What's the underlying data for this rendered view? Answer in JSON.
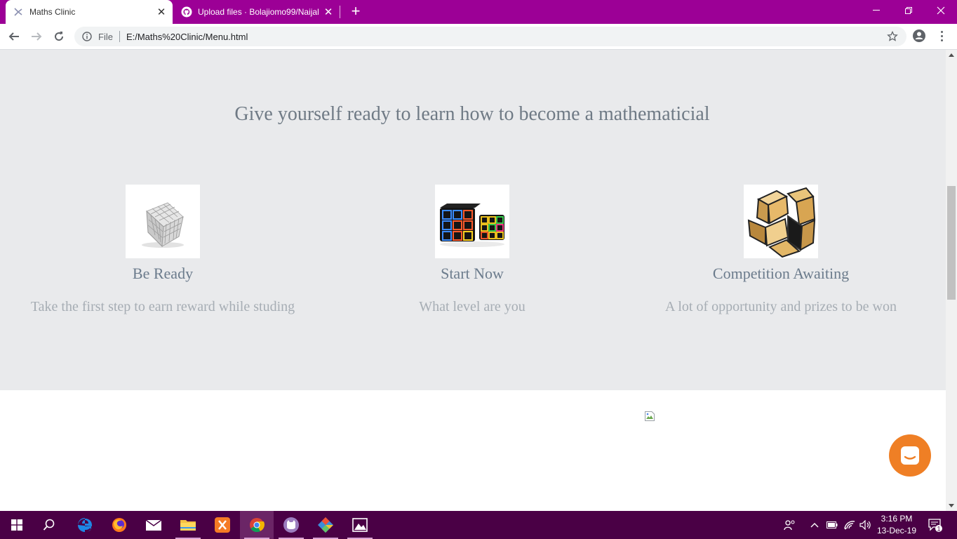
{
  "browser": {
    "tabs": [
      {
        "title": "Maths Clinic",
        "active": true
      },
      {
        "title": "Upload files · Bolajiomo99/Naijal",
        "active": false
      }
    ],
    "address": {
      "scheme": "File",
      "url": "E:/Maths%20Clinic/Menu.html"
    }
  },
  "page": {
    "hero_title": "Give yourself ready to learn how to become a mathematicial",
    "features": [
      {
        "title": "Be Ready",
        "description": "Take the first step to earn reward while studing",
        "icon": "magnetic-cube-image"
      },
      {
        "title": "Start Now",
        "description": "What level are you",
        "icon": "rubiks-cubes-image"
      },
      {
        "title": "Competition Awaiting",
        "description": "A lot of opportunity and prizes to be won",
        "icon": "mirror-cube-image"
      }
    ]
  },
  "taskbar": {
    "apps": [
      "start-icon",
      "search-icon",
      "edge-icon",
      "firefox-icon",
      "mail-icon",
      "file-explorer-icon",
      "xampp-icon",
      "chrome-icon",
      "github-desktop-icon",
      "git-icon",
      "photos-icon"
    ],
    "clock": {
      "time": "3:16 PM",
      "date": "13-Dec-19"
    },
    "notification_count": "1"
  },
  "colors": {
    "titlebar": "#9c0096",
    "taskbar": "#4a0045",
    "hero_bg": "#e9eaec",
    "chat_button": "#ef7f25"
  }
}
